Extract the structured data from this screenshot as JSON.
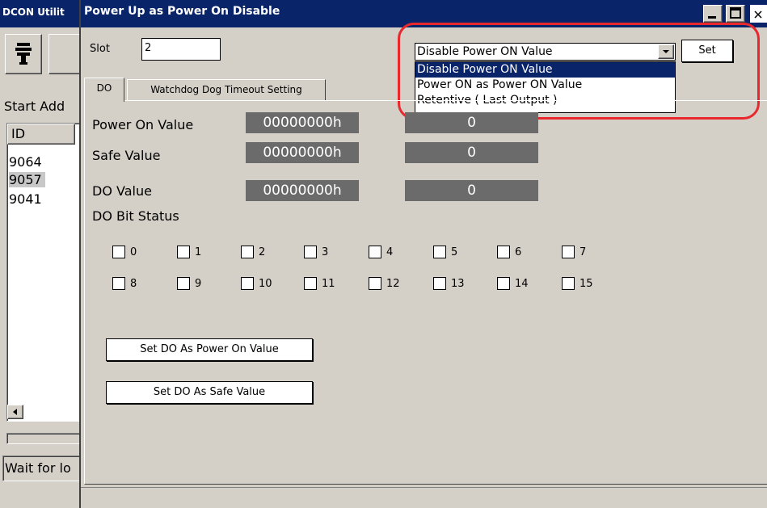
{
  "bg_window": {
    "title": "DCON Utilit",
    "start_address_label": "Start Add",
    "list_header": "ID",
    "ids": [
      "9064",
      "9057",
      "9041"
    ],
    "status_text": "Wait for lo"
  },
  "dialog": {
    "title": "Power Up as Power On Disable",
    "slot_label": "Slot",
    "slot_value": "2",
    "mode_select": {
      "selected": "Disable Power ON Value",
      "options": [
        "Disable Power ON Value",
        "Power ON as Power ON Value",
        "Retentive ( Last Output )"
      ],
      "highlighted_index": 0
    },
    "set_button": "Set",
    "tabs": [
      {
        "label": "DO",
        "active": true
      },
      {
        "label": "Watchdog Dog Timeout Setting",
        "active": false
      }
    ],
    "power_on": {
      "label": "Power On Value",
      "hex": "00000000h",
      "dec": "0"
    },
    "safe": {
      "label": "Safe Value",
      "hex": "00000000h",
      "dec": "0"
    },
    "do_value": {
      "label": "DO Value",
      "hex": "00000000h",
      "dec": "0"
    },
    "bit_status_label": "DO Bit Status",
    "bits": [
      "0",
      "1",
      "2",
      "3",
      "4",
      "5",
      "6",
      "7",
      "8",
      "9",
      "10",
      "11",
      "12",
      "13",
      "14",
      "15"
    ],
    "set_power_on_button": "Set DO As Power On Value",
    "set_safe_button": "Set DO As Safe Value"
  },
  "colors": {
    "titlebar": "#0a246a",
    "value_box": "#6b6b6b",
    "highlight": "#0a246a",
    "callout": "#e8282d"
  }
}
